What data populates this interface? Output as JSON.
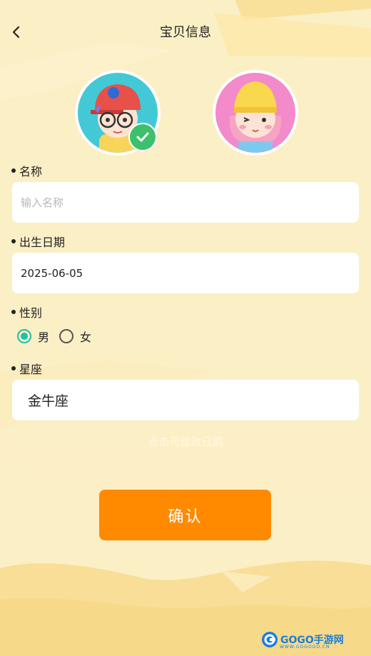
{
  "header": {
    "title": "宝贝信息"
  },
  "icons": {
    "back": "chevron-left-icon",
    "check": "checkmark-icon"
  },
  "avatars": [
    {
      "name": "avatar-boy",
      "selected": true
    },
    {
      "name": "avatar-girl",
      "selected": false
    }
  ],
  "form": {
    "name": {
      "label": "名称",
      "placeholder": "输入名称",
      "value": ""
    },
    "birth_date": {
      "label": "出生日期",
      "value": "2025-06-05"
    },
    "gender": {
      "label": "性别",
      "options": [
        "男",
        "女"
      ],
      "selected": "男"
    },
    "zodiac": {
      "label": "星座",
      "value": "金牛座"
    },
    "hint": "点击可修改日期"
  },
  "confirm_button": {
    "label": "确认"
  },
  "watermark": {
    "brand": "GOGO手游网",
    "url": "WWW.GOGOGO.CN"
  },
  "colors": {
    "background": "#fbefc6",
    "accent": "#ff8a00",
    "radio_active": "#1fbfa8",
    "check_badge": "#3cc06c"
  }
}
